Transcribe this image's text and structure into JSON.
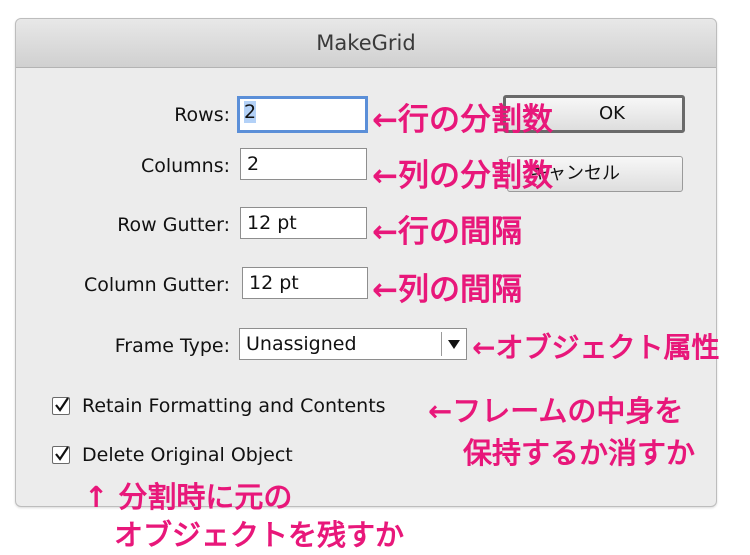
{
  "dialog": {
    "title": "MakeGrid",
    "rows_label": "Rows:",
    "rows_value": "2",
    "columns_label": "Columns:",
    "columns_value": "2",
    "row_gutter_label": "Row Gutter:",
    "row_gutter_value": "12 pt",
    "column_gutter_label": "Column Gutter:",
    "column_gutter_value": "12 pt",
    "frame_type_label": "Frame Type:",
    "frame_type_value": "Unassigned",
    "ok_label": "OK",
    "cancel_label": "キャンセル",
    "retain_label": "Retain Formatting and Contents",
    "retain_checked": true,
    "delete_label": "Delete Original Object",
    "delete_checked": true
  },
  "annotations": {
    "rows_note": "←行の分割数",
    "columns_note": "←列の分割数",
    "row_gutter_note": "←行の間隔",
    "column_gutter_note": "←列の間隔",
    "frame_type_note": "←オブジェクト属性",
    "retain_note_1": "←フレームの中身を",
    "retain_note_2": "保持するか消すか",
    "delete_note_1": "↑ 分割時に元の",
    "delete_note_2": "オブジェクトを残すか"
  },
  "colors": {
    "annotation": "#e8177a",
    "focus_ring": "#5b8fd8"
  }
}
